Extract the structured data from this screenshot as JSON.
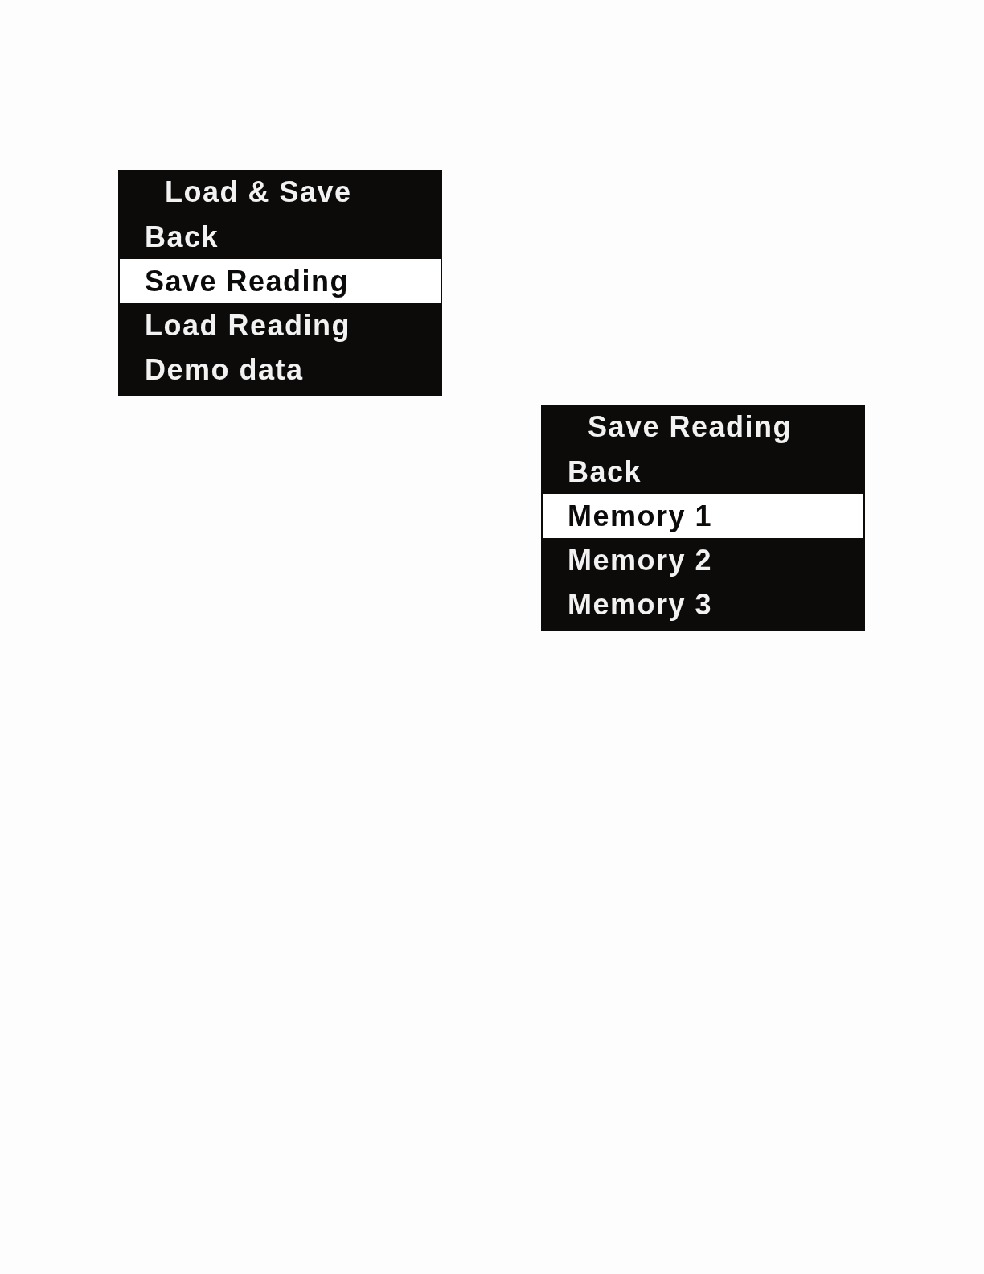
{
  "screens": [
    {
      "title": "Load & Save",
      "items": [
        {
          "label": "Back",
          "selected": false
        },
        {
          "label": "Save Reading",
          "selected": true
        },
        {
          "label": "Load Reading",
          "selected": false
        },
        {
          "label": "Demo data",
          "selected": false
        }
      ]
    },
    {
      "title": "Save Reading",
      "items": [
        {
          "label": "Back",
          "selected": false
        },
        {
          "label": "Memory 1",
          "selected": true
        },
        {
          "label": "Memory 2",
          "selected": false
        },
        {
          "label": "Memory 3",
          "selected": false
        }
      ]
    }
  ]
}
